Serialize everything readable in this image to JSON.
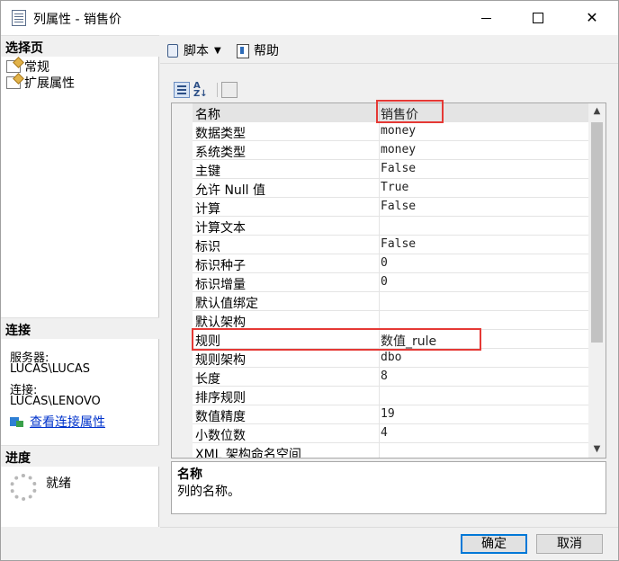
{
  "window": {
    "title": "列属性 - 销售价"
  },
  "left_pane": {
    "select_page_header": "选择页",
    "pages": [
      {
        "label": "常规",
        "icon": "page-settings-icon"
      },
      {
        "label": "扩展属性",
        "icon": "page-settings-icon"
      }
    ],
    "connection_header": "连接",
    "server_label": "服务器:",
    "server_value": "LUCAS\\LUCAS",
    "connection_label": "连接:",
    "connection_value": "LUCAS\\LENOVO",
    "view_connection_link": "查看连接属性",
    "progress_header": "进度",
    "progress_status": "就绪"
  },
  "toolbar": {
    "script_label": "脚本",
    "help_label": "帮助"
  },
  "properties": [
    {
      "name": "名称",
      "value": "销售价"
    },
    {
      "name": "数据类型",
      "value": "money"
    },
    {
      "name": "系统类型",
      "value": "money"
    },
    {
      "name": "主键",
      "value": "False"
    },
    {
      "name": "允许 Null 值",
      "value": "True"
    },
    {
      "name": "计算",
      "value": "False"
    },
    {
      "name": "计算文本",
      "value": ""
    },
    {
      "name": "标识",
      "value": "False"
    },
    {
      "name": "标识种子",
      "value": "0"
    },
    {
      "name": "标识增量",
      "value": "0"
    },
    {
      "name": "默认值绑定",
      "value": ""
    },
    {
      "name": "默认架构",
      "value": ""
    },
    {
      "name": "规则",
      "value": "数值_rule"
    },
    {
      "name": "规则架构",
      "value": "dbo"
    },
    {
      "name": "长度",
      "value": "8"
    },
    {
      "name": "排序规则",
      "value": ""
    },
    {
      "name": "数值精度",
      "value": "19"
    },
    {
      "name": "小数位数",
      "value": "4"
    },
    {
      "name": "XML 架构命名空间",
      "value": ""
    }
  ],
  "description": {
    "title": "名称",
    "text": "列的名称。"
  },
  "buttons": {
    "ok": "确定",
    "cancel": "取消"
  },
  "colors": {
    "highlight_box": "#e53935",
    "link": "#0033cc",
    "ok_border": "#0078d7"
  }
}
